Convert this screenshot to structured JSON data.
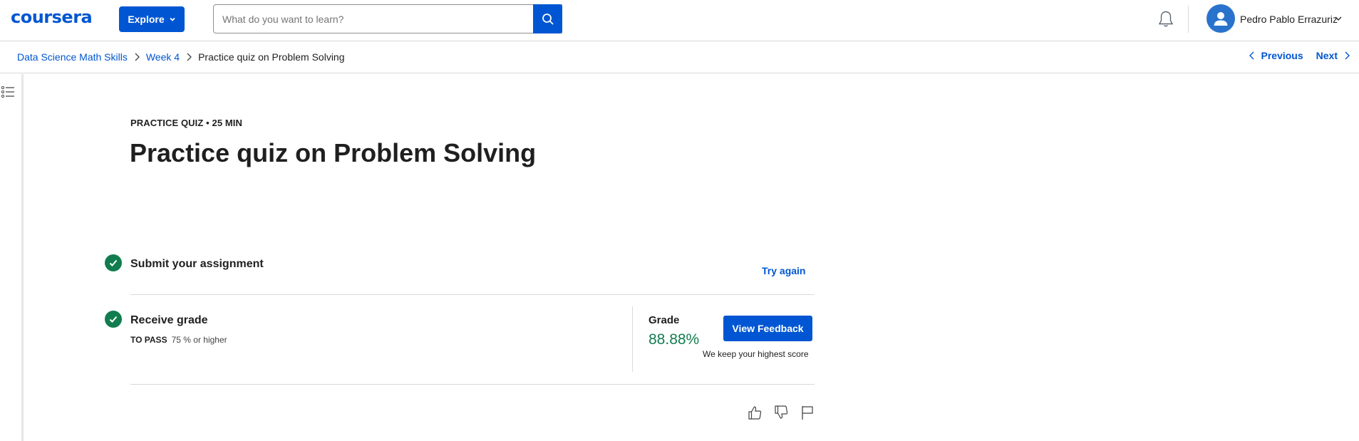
{
  "header": {
    "logo_text": "coursera",
    "explore_label": "Explore",
    "search": {
      "placeholder": "What do you want to learn?",
      "value": ""
    },
    "user_name": "Pedro Pablo Errazuriz"
  },
  "breadcrumb": {
    "items": [
      {
        "label": "Data Science Math Skills"
      },
      {
        "label": "Week 4"
      },
      {
        "label": "Practice quiz on Problem Solving"
      }
    ]
  },
  "nav": {
    "previous_label": "Previous",
    "next_label": "Next"
  },
  "quiz": {
    "eyebrow": "PRACTICE QUIZ • 25 MIN",
    "title": "Practice quiz on Problem Solving"
  },
  "steps": {
    "submit": {
      "title": "Submit your assignment",
      "action_label": "Try again"
    },
    "receive": {
      "title": "Receive grade",
      "to_pass_label": "TO PASS",
      "to_pass_value": "75 % or higher"
    }
  },
  "grade": {
    "label": "Grade",
    "value": "88.88%",
    "feedback_button": "View Feedback",
    "note": "We keep your highest score"
  },
  "colors": {
    "brand_blue": "#0056d2",
    "success_green": "#117d4e",
    "avatar_blue": "#2a73cc",
    "divider": "#dadada"
  },
  "icons": [
    "chevron-down-icon",
    "search-icon",
    "bell-icon",
    "user-avatar-icon",
    "chevron-right-icon",
    "chevron-left-icon",
    "outline-list-icon",
    "checkmark-icon",
    "thumbs-up-icon",
    "thumbs-down-icon",
    "flag-icon"
  ]
}
